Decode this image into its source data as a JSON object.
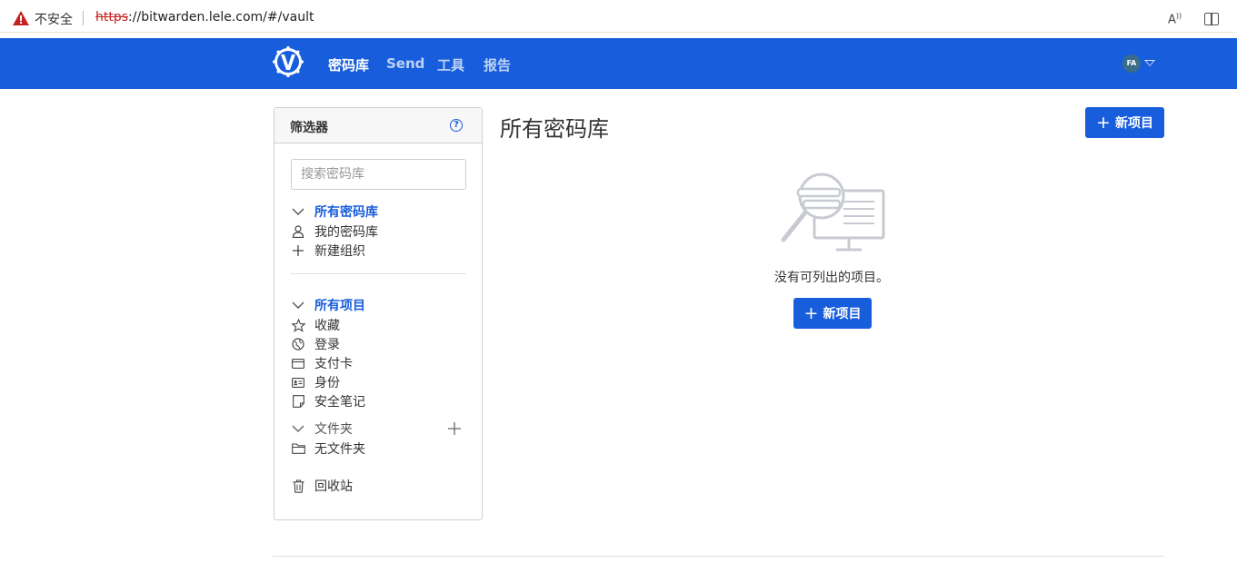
{
  "browser": {
    "security_label": "不安全",
    "url_scheme": "https",
    "url_rest": "://bitwarden.lele.com/#/vault"
  },
  "nav": {
    "items": [
      {
        "label": "密码库",
        "active": true
      },
      {
        "label": "Send",
        "active": false
      },
      {
        "label": "工具",
        "active": false
      },
      {
        "label": "报告",
        "active": false
      }
    ],
    "avatar_initials": "FA",
    "brand_color": "#175ddc"
  },
  "filter": {
    "title": "筛选器",
    "search_placeholder": "搜索密码库",
    "vaults_header": "所有密码库",
    "vault_items": [
      "我的密码库",
      "新建组织"
    ],
    "items_header": "所有项目",
    "type_items": [
      "收藏",
      "登录",
      "支付卡",
      "身份",
      "安全笔记"
    ],
    "folders_header": "文件夹",
    "folder_items": [
      "无文件夹"
    ],
    "trash_label": "回收站"
  },
  "main": {
    "title": "所有密码库",
    "new_item_label": "新项目",
    "empty_text": "没有可列出的项目。",
    "empty_new_item_label": "新项目"
  }
}
